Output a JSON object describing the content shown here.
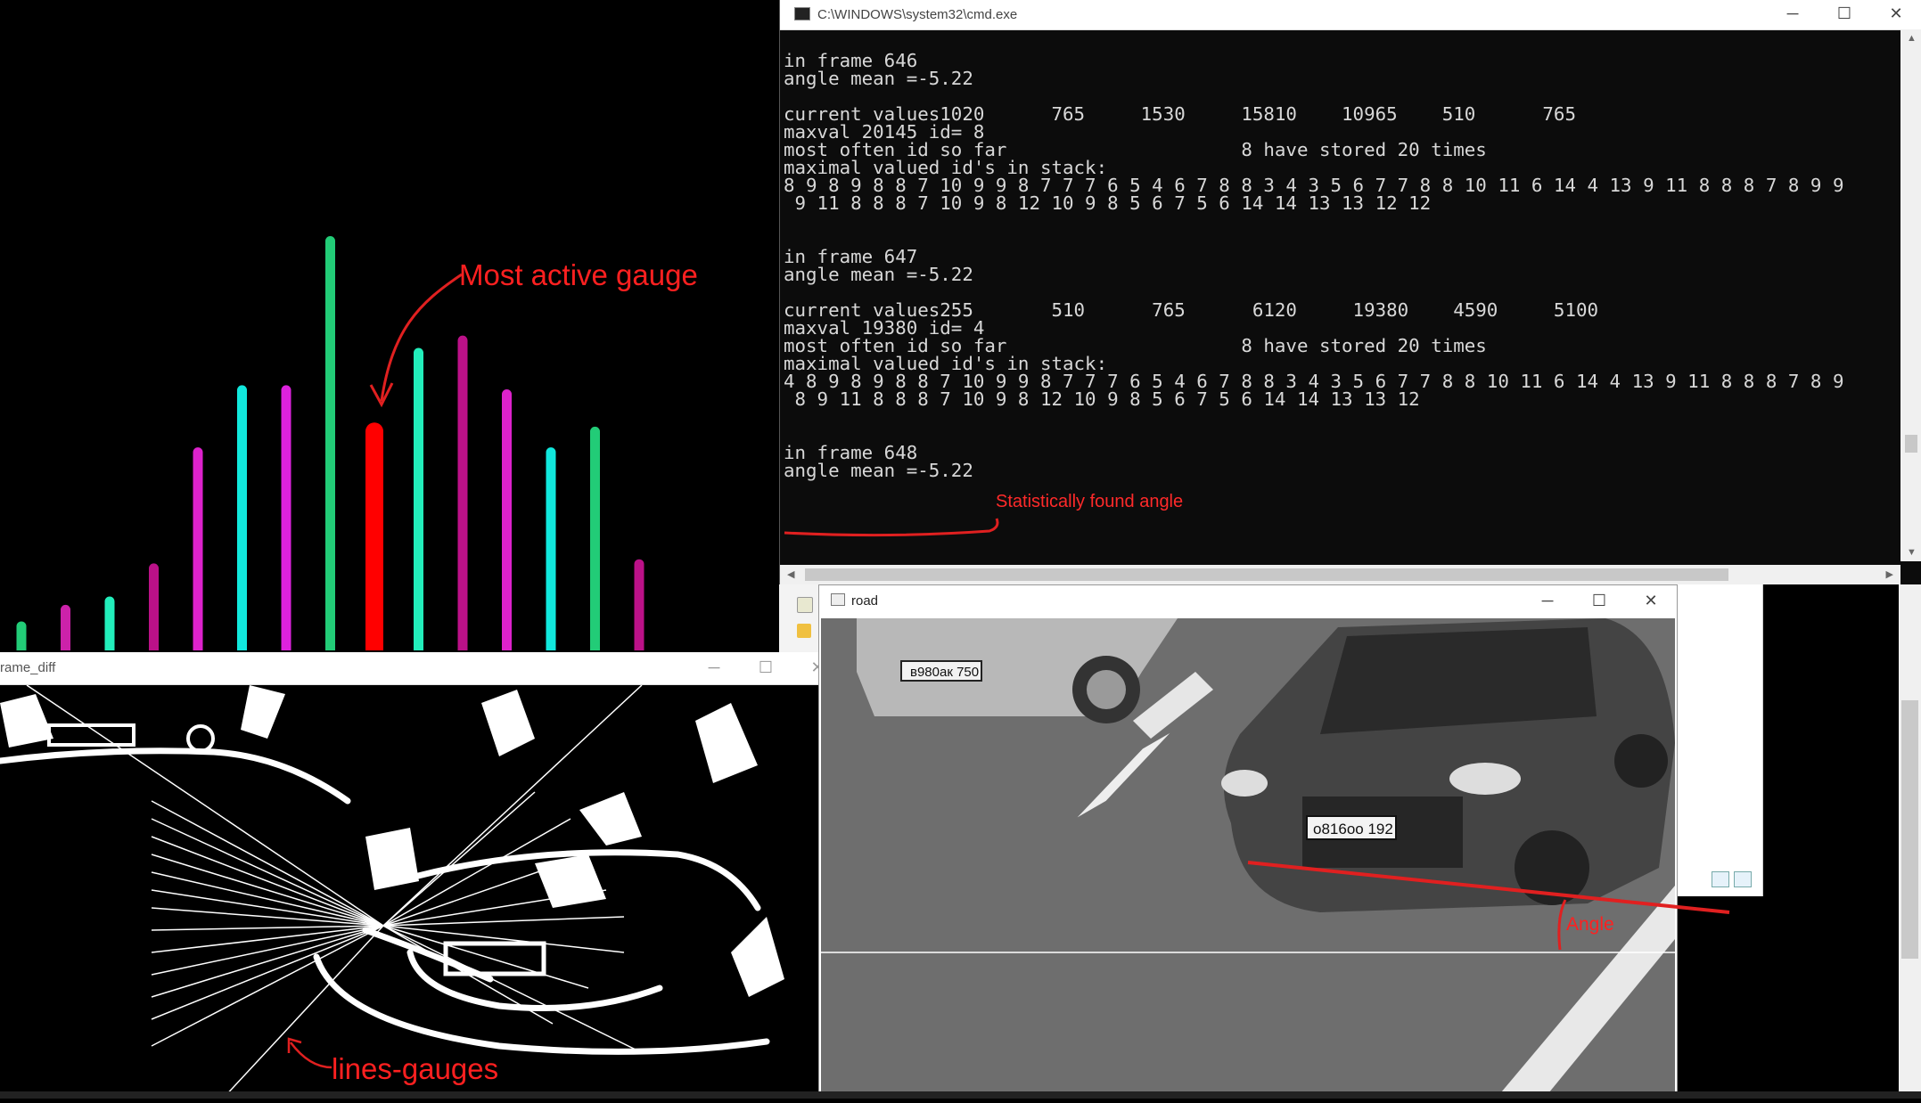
{
  "bars": {
    "values": [
      0.07,
      0.11,
      0.13,
      0.21,
      0.49,
      0.64,
      0.64,
      1.0,
      0.55,
      0.73,
      0.76,
      0.63,
      0.49,
      0.54,
      0.22
    ],
    "colors": [
      "#22cc77",
      "#cc22aa",
      "#22eebb",
      "#bb1188",
      "#dd22cc",
      "#11e8dd",
      "#dd22dd",
      "#22cc77",
      "#ff0000",
      "#22eebb",
      "#bb1188",
      "#dd22cc",
      "#11e8dd",
      "#22cc77",
      "#bb1188"
    ]
  },
  "annotations": {
    "most_active": "Most active gauge",
    "lines_gauges": "lines-gauges",
    "statistically": "Statistically found angle",
    "angle": "Angle"
  },
  "cmd": {
    "title": "C:\\WINDOWS\\system32\\cmd.exe",
    "lines": [
      "",
      "in frame 646",
      "angle mean =-5.22",
      "",
      "current values1020      765     1530     15810    10965    510      765",
      "maxval 20145 id= 8",
      "most often id so far                     8 have stored 20 times",
      "maximal valued id's in stack:",
      "8 9 8 9 8 8 7 10 9 9 8 7 7 7 6 5 4 6 7 8 8 3 4 3 5 6 7 7 8 8 10 11 6 14 4 13 9 11 8 8 8 7 8 9 9",
      " 9 11 8 8 8 7 10 9 8 12 10 9 8 5 6 7 5 6 14 14 13 13 12 12",
      "",
      "",
      "in frame 647",
      "angle mean =-5.22",
      "",
      "current values255       510      765      6120     19380    4590     5100",
      "maxval 19380 id= 4",
      "most often id so far                     8 have stored 20 times",
      "maximal valued id's in stack:",
      "4 8 9 8 9 8 8 7 10 9 9 8 7 7 7 6 5 4 6 7 8 8 3 4 3 5 6 7 7 8 8 10 11 6 14 4 13 9 11 8 8 8 7 8 9",
      " 8 9 11 8 8 8 7 10 9 8 12 10 9 8 5 6 7 5 6 14 14 13 13 12",
      "",
      "",
      "in frame 648",
      "angle mean =-5.22"
    ],
    "scroll_up": "▲",
    "scroll_down": "▼",
    "scroll_left": "◀",
    "scroll_right": "▶"
  },
  "window_buttons": {
    "minimize": "─",
    "maximize": "☐",
    "close": "✕"
  },
  "diff": {
    "title": "rame_diff"
  },
  "road": {
    "title": "road",
    "plate_front": "o816oo 192",
    "plate_back": "в980ак 750"
  }
}
